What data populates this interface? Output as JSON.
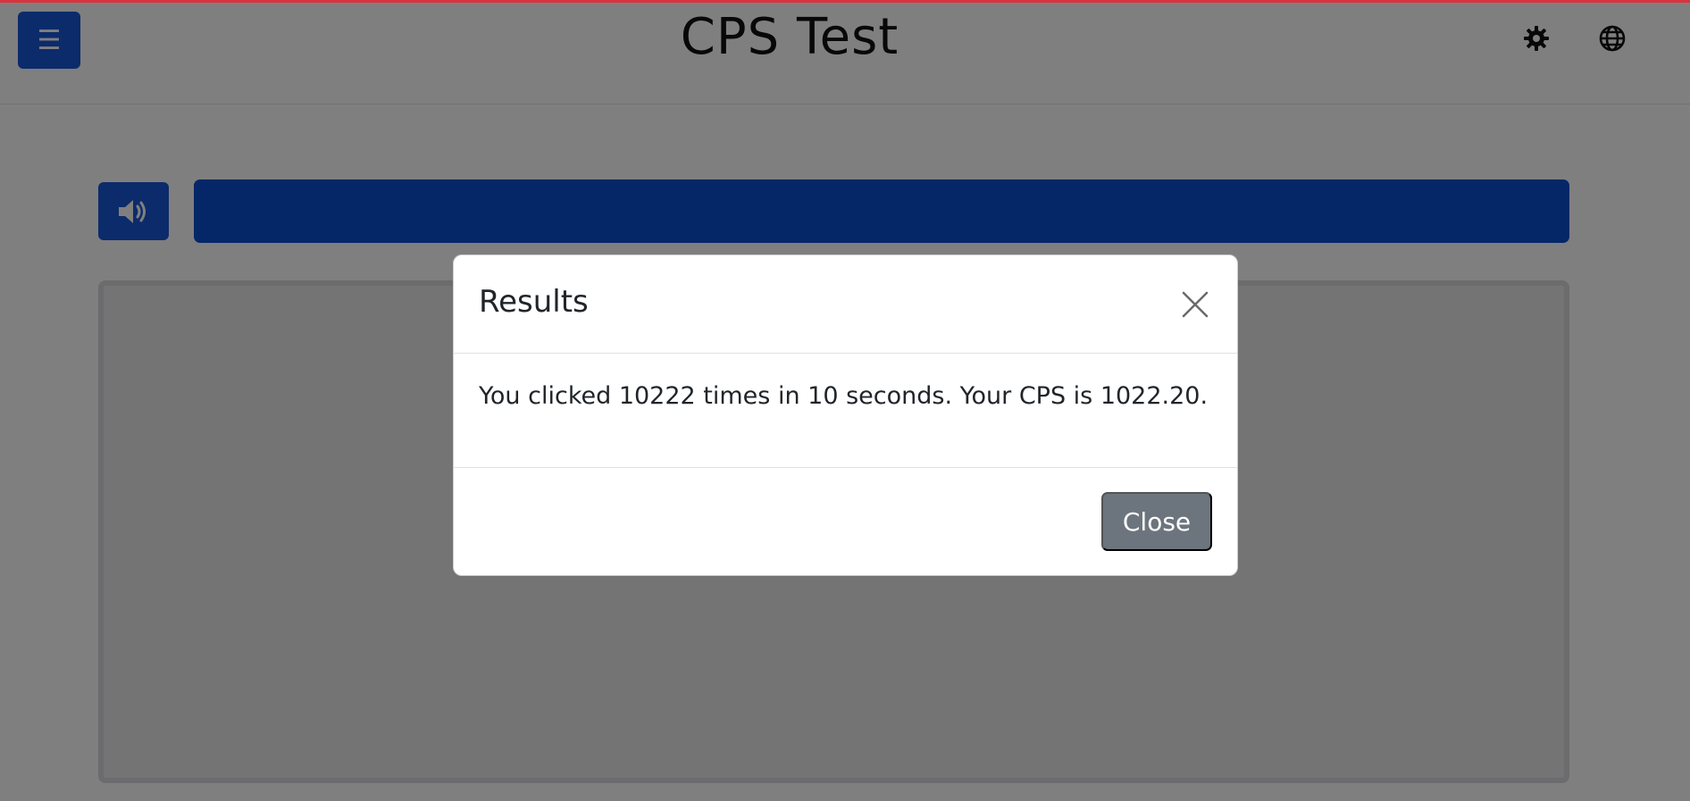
{
  "header": {
    "title": "CPS Test",
    "menu_icon": "☰",
    "icons": [
      "gear-icon",
      "globe-icon"
    ]
  },
  "test": {
    "sound_icon": "speaker-volume-icon",
    "progress_fraction": 1.0
  },
  "modal": {
    "title": "Results",
    "close_icon": "close-icon",
    "message": "You clicked 10222 times in 10 seconds. Your CPS is 1022.20.",
    "close_label": "Close"
  },
  "colors": {
    "primary": "#1857d6",
    "top_border": "#d9323e",
    "secondary_button": "#6c757d"
  }
}
